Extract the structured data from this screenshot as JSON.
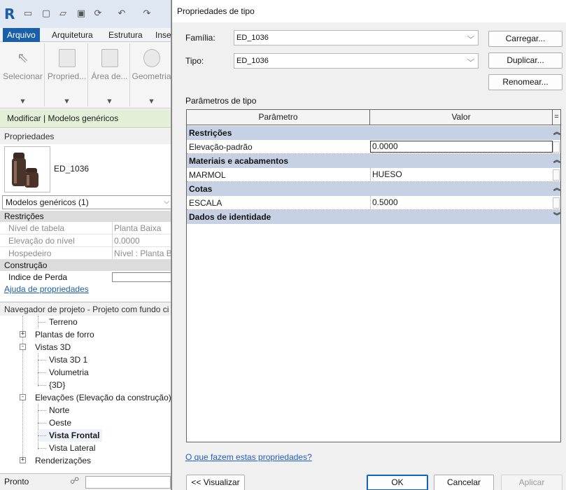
{
  "app": {
    "qat_icons": [
      "revit-logo",
      "open-icon",
      "new-icon",
      "folder-icon",
      "save-icon",
      "sync-icon",
      "undo-icon",
      "redo-icon"
    ],
    "logo_text": "R",
    "ribbon_tabs": [
      {
        "label": "Arquivo",
        "active": true
      },
      {
        "label": "Arquitetura",
        "active": false
      },
      {
        "label": "Estrutura",
        "active": false
      },
      {
        "label": "Inse",
        "active": false
      }
    ],
    "ribbon_buttons": [
      {
        "label": "Selecionar",
        "icon": "pointer-icon"
      },
      {
        "label": "Propried...",
        "icon": "properties-icon"
      },
      {
        "label": "Área de...",
        "icon": "clipboard-icon"
      },
      {
        "label": "Geometria",
        "icon": "geometry-icon"
      }
    ],
    "context_label": "Modificar | Modelos genéricos",
    "properties": {
      "header": "Propriedades",
      "type_name": "ED_1036",
      "filter": "Modelos genéricos (1)",
      "categories": [
        {
          "name": "Restrições",
          "rows": [
            {
              "key": "Nível de tabela",
              "value": "Planta Baixa"
            },
            {
              "key": "Elevação do nível",
              "value": "0.0000"
            },
            {
              "key": "Hospedeiro",
              "value": "Nível : Planta Ba"
            }
          ]
        },
        {
          "name": "Construção",
          "rows": [
            {
              "key": "Indice de Perda",
              "value": ""
            }
          ]
        }
      ],
      "help_link": "Ajuda de propriedades"
    },
    "browser": {
      "header": "Navegador de projeto - Projeto com fundo ci",
      "items": [
        {
          "label": "Terreno",
          "level": 2,
          "expander": ""
        },
        {
          "label": "Plantas de forro",
          "level": 1,
          "expander": "+"
        },
        {
          "label": "Vistas 3D",
          "level": 1,
          "expander": "-"
        },
        {
          "label": "Vista 3D 1",
          "level": 2,
          "expander": ""
        },
        {
          "label": "Volumetria",
          "level": 2,
          "expander": ""
        },
        {
          "label": "{3D}",
          "level": 2,
          "expander": ""
        },
        {
          "label": "Elevações (Elevação da construção)",
          "level": 1,
          "expander": "-"
        },
        {
          "label": "Norte",
          "level": 2,
          "expander": ""
        },
        {
          "label": "Oeste",
          "level": 2,
          "expander": ""
        },
        {
          "label": "Vista Frontal",
          "level": 2,
          "expander": "",
          "selected": true
        },
        {
          "label": "Vista Lateral",
          "level": 2,
          "expander": ""
        },
        {
          "label": "Renderizações",
          "level": 1,
          "expander": "+"
        }
      ]
    },
    "status": {
      "text": "Pronto",
      "icon": "network-icon"
    }
  },
  "dialog": {
    "title": "Propriedades de tipo",
    "family_label": "Família:",
    "family_value": "ED_1036",
    "type_label": "Tipo:",
    "type_value": "ED_1036",
    "buttons": {
      "load": "Carregar...",
      "duplicate": "Duplicar...",
      "rename": "Renomear...",
      "preview": "<< Visualizar",
      "ok": "OK",
      "cancel": "Cancelar",
      "apply": "Aplicar"
    },
    "section_label": "Parâmetros de tipo",
    "grid": {
      "col_param": "Parâmetro",
      "col_value": "Valor",
      "col_toggle": "=",
      "categories": [
        {
          "name": "Restrições",
          "collapsed": false,
          "rows": [
            {
              "param": "Elevação-padrão",
              "value": "0.0000",
              "editing": true
            }
          ]
        },
        {
          "name": "Materiais e acabamentos",
          "collapsed": false,
          "rows": [
            {
              "param": "MARMOL",
              "value": "HUESO",
              "editing": false
            }
          ]
        },
        {
          "name": "Cotas",
          "collapsed": false,
          "rows": [
            {
              "param": "ESCALA",
              "value": "0.5000",
              "editing": false
            }
          ]
        },
        {
          "name": "Dados de identidade",
          "collapsed": true,
          "rows": []
        }
      ]
    },
    "help_link": "O que fazem estas propriedades?",
    "colors": {
      "category_band": "#c6d2e3",
      "default_button_border": "#0a64c8",
      "link": "#1e5fc3",
      "context_band": "#e3efd6"
    }
  }
}
